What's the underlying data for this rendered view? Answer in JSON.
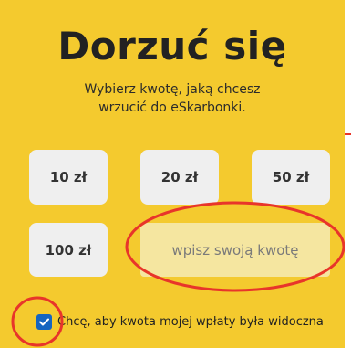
{
  "heading": {
    "title": "Dorzuć się",
    "subtitle": "Wybierz kwotę, jaką chcesz wrzucić do eSkarbonki."
  },
  "amounts": [
    {
      "label": "10 zł"
    },
    {
      "label": "20 zł"
    },
    {
      "label": "50 zł"
    },
    {
      "label": "100 zł"
    }
  ],
  "custom_amount": {
    "placeholder": "wpisz swoją kwotę",
    "value": ""
  },
  "visibility": {
    "checked": true,
    "label": "Chcę, aby kwota mojej wpłaty była widoczna"
  },
  "colors": {
    "background": "#f4ca2e",
    "button": "#efefef",
    "input": "#f5e6a0",
    "checkbox": "#1565c0",
    "annotation": "#e8352a"
  },
  "icons": {
    "checkbox": "check-icon"
  }
}
